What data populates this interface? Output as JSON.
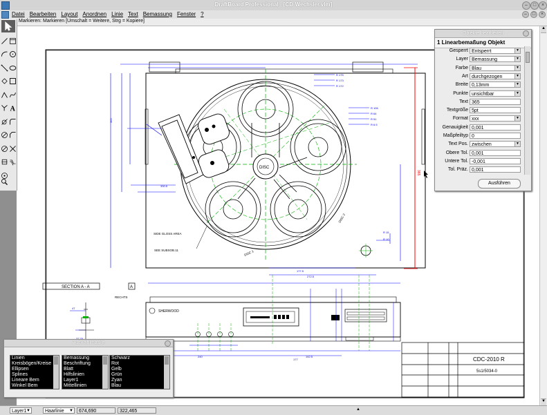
{
  "window": {
    "title": "DraftBoard Professional - [CD-Wechsler.vlm]"
  },
  "menu": [
    "Datei",
    "Bearbeiten",
    "Layout",
    "Anordnen",
    "Linie",
    "Text",
    "Bemassung",
    "Fenster",
    "?"
  ],
  "hint": "Markieren: Markieren  [Umschalt = Weitere, Strg = Kopiere]",
  "tools": [
    "pointer-icon",
    "line-icon",
    "rectangle-frame-icon",
    "arc-icon",
    "circle-icon",
    "diagonal-line-icon",
    "ellipse-icon",
    "rotated-rectangle-icon",
    "square-icon",
    "angle-icon",
    "spline-icon",
    "intersection-icon",
    "text-icon",
    "circle-tangent-icon",
    "fillet-icon",
    "polygon-icon",
    "chamfer-icon",
    "no-entry-icon",
    "trim-icon",
    "crosshair-icon",
    "offset-icon",
    "center-point-icon",
    "zoom-icon"
  ],
  "objects_panel": {
    "title": "Objekte bearbeiten",
    "header": "1 Linearbemaßung Objekt",
    "rows": [
      {
        "label": "Gesperrt",
        "value": "Entsperrt",
        "dropdown": true
      },
      {
        "label": "Layer",
        "value": "Bemassung",
        "dropdown": true
      },
      {
        "label": "Farbe",
        "value": "Blau",
        "dropdown": true
      },
      {
        "label": "Art",
        "value": "durchgezogen",
        "dropdown": true
      },
      {
        "label": "Breite",
        "value": "0,13mm",
        "dropdown": true
      },
      {
        "label": "Punkte",
        "value": "unsichtbar",
        "dropdown": true
      },
      {
        "label": "Text",
        "value": "365",
        "dropdown": false
      },
      {
        "label": "Textgröße",
        "value": "5pt",
        "dropdown": false
      },
      {
        "label": "Format",
        "value": "xxx",
        "dropdown": true
      },
      {
        "label": "Genauigkeit",
        "value": "0,001",
        "dropdown": false
      },
      {
        "label": "Maßpfeiltyp",
        "value": "0",
        "dropdown": false
      },
      {
        "label": "Text Pos.",
        "value": "zwischen",
        "dropdown": true
      },
      {
        "label": "Obere Tol.",
        "value": "0,001",
        "dropdown": false
      },
      {
        "label": "Untere Tol.",
        "value": "-0,001",
        "dropdown": false
      },
      {
        "label": "Tol. Präz.",
        "value": "0,001",
        "dropdown": false
      }
    ],
    "execute_label": "Ausführen"
  },
  "selection_panel": {
    "title": "Auswahlmaske",
    "list1": [
      "Linien",
      "Kreisbögen/Kreise",
      "Ellipsen",
      "Splines",
      "Lineare Bem",
      "Winkel Bem"
    ],
    "list2": [
      "Bemassung",
      "Beschriftung",
      "Blatt",
      "Hilfslinien",
      "Layer1",
      "Mittellinien"
    ],
    "list3": [
      "Schwarz",
      "Rot",
      "Gelb",
      "Grün",
      "Zyan",
      "Blau"
    ]
  },
  "status": {
    "layer": "Layer1",
    "linetype": "Haarlinie",
    "x": "674,690",
    "y": "322,465"
  },
  "drawing": {
    "section_label": "SECTION A - A",
    "side_label": "A",
    "title_block": {
      "name": "CDC-2010 R",
      "number": "5s1/5034-0"
    },
    "annotations": [
      "DISC",
      "DISC 1",
      "DISC 2",
      "SIDE GLOSS AREA",
      "SEE SUBSOB.11",
      "SHERWOOD",
      "RECHTS"
    ]
  },
  "colors": {
    "accent_red": "#ff0000",
    "dim_blue": "#0000ff",
    "center_green": "#00c000"
  }
}
